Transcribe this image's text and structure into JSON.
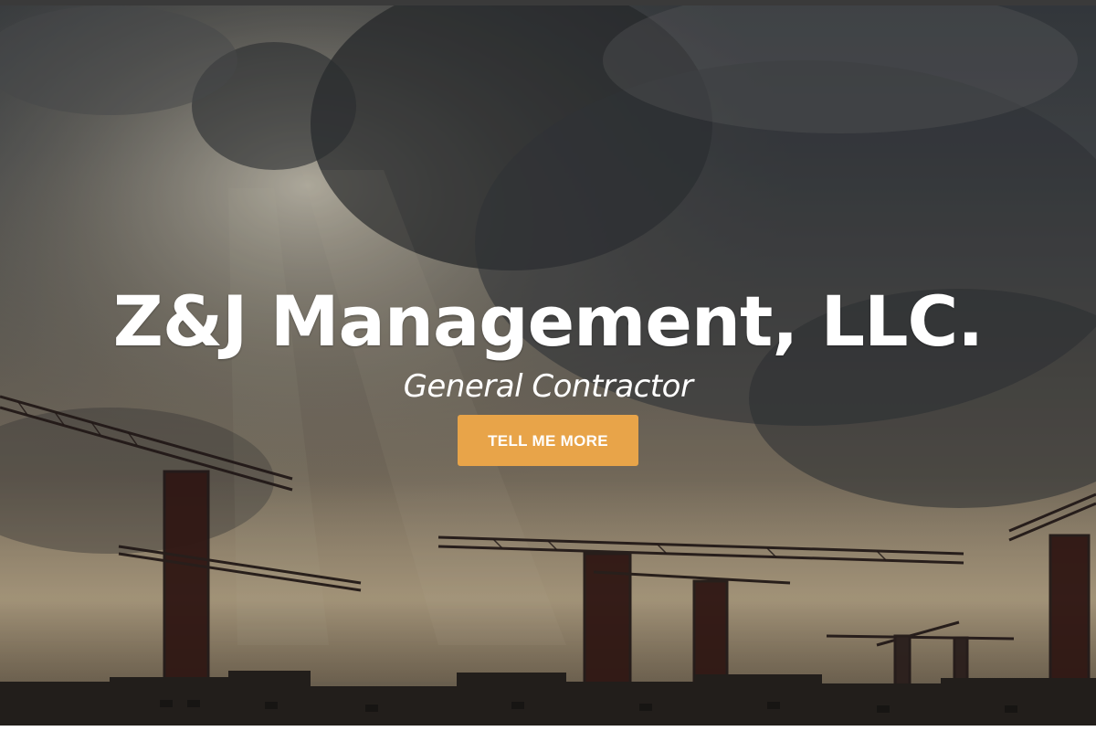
{
  "hero": {
    "title": "Z&J Management, LLC.",
    "subtitle": "General Contractor",
    "cta_label": "TELL ME MORE",
    "background_image": "construction-cranes-cloudy-sky"
  },
  "colors": {
    "cta_background": "#e8a449",
    "text": "#ffffff",
    "topbar": "#3a3a3a"
  }
}
